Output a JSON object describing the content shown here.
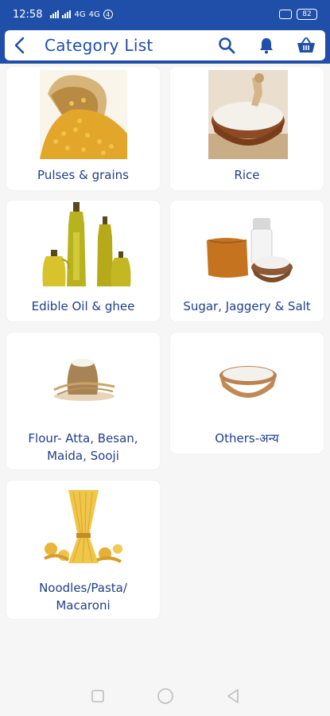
{
  "status": {
    "time": "12:58",
    "signal1": "4G",
    "signal2": "4G",
    "notif": "4",
    "battery": "82"
  },
  "appbar": {
    "title": "Category List",
    "icons": [
      "back-arrow-icon",
      "search-icon",
      "bell-icon",
      "basket-icon"
    ]
  },
  "colors": {
    "brand_blue": "#1f4fa8",
    "label_blue": "#1f3f8a",
    "background": "#f6f6f6"
  },
  "categories": [
    {
      "label": "Pulses & grains",
      "image": "lentils-bowl"
    },
    {
      "label": "Rice",
      "image": "rice-bowl-with-scoop"
    },
    {
      "label": "Edible Oil & ghee",
      "image": "oil-bottles"
    },
    {
      "label": "Sugar, Jaggery & Salt",
      "image": "jaggery-and-salt"
    },
    {
      "label": "Flour- Atta, Besan, Maida, Sooji",
      "image": "flour-sack-and-wheat"
    },
    {
      "label": "Others-अन्य",
      "image": "wooden-bowl-powder"
    },
    {
      "label": "Noodles/Pasta/ Macaroni",
      "image": "pasta-bundle"
    }
  ],
  "navbar": [
    "recents-square-icon",
    "home-circle-icon",
    "back-triangle-icon"
  ]
}
